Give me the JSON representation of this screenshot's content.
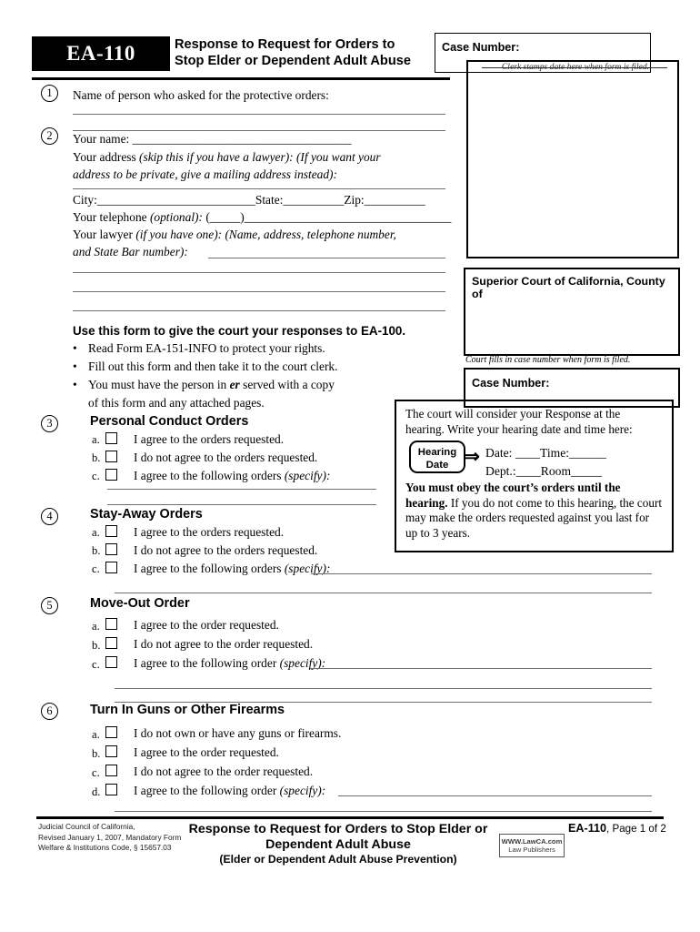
{
  "header": {
    "form_code": "EA-110",
    "title_line1": "Response to Request for Orders to",
    "title_line2": "Stop Elder or Dependent Adult Abuse"
  },
  "case_number_top": {
    "label": "Case Number:"
  },
  "clerk_stamp": {
    "note": "Clerk stamps date here when form is filed."
  },
  "court_box": {
    "label": "Superior Court of California, County of"
  },
  "court_fills_note": "Court fills in case number when form is filed.",
  "case_number_bottom": {
    "label": "Case Number:"
  },
  "hearing": {
    "intro_line1": "The court will consider your Response at the",
    "intro_line2": "hearing. Write your hearing date and time here:",
    "badge_line1": "Hearing",
    "badge_line2": "Date",
    "arrow": "⇒",
    "field_date": "Date: ____",
    "field_time": "Time:______",
    "field_dept": "Dept.:____",
    "field_room": "Room_____",
    "warn_bold": "You must obey the court’s orders until the hearing.",
    "warn_rest": " If you do not come to this hearing, the court may make the orders requested against you last for up to 3 years."
  },
  "item1": {
    "number": "1",
    "text": "Name of person who asked for the protective orders:"
  },
  "item2": {
    "number": "2",
    "your_name": "Your name: ____________________________________",
    "address_line1_plain": "Your address ",
    "address_line1_italic": "(skip this if you have a lawyer): (If you want your",
    "address_line2_italic": "address to be private, give a mailing address instead):",
    "city_line": "City:__________________________State:__________Zip:__________",
    "telephone_plain": "Your telephone ",
    "telephone_italic": "(optional): ",
    "telephone_rest": "(_____)__________________________________",
    "lawyer_plain": "Your lawyer ",
    "lawyer_italic1": "(if you have one): (Name, address, telephone number,",
    "lawyer_italic2": "and State Bar number):"
  },
  "instructions": {
    "heading": "Use this form to give the court your responses to EA-100.",
    "bullets": [
      "Read Form EA-151-INFO to protect your rights.",
      "Fill out this form and then take it to the court clerk.",
      "You must have the person in er served with a copy",
      "of this form and any attached pages."
    ],
    "bullet3_pre": "You must have the person in ",
    "bullet3_glyph": "er",
    "bullet3_post": " served with a copy",
    "bullet_marker": "•"
  },
  "item3": {
    "number": "3",
    "heading": "Personal Conduct Orders",
    "options": [
      {
        "letter": "a.",
        "text": "I agree to the orders requested."
      },
      {
        "letter": "b.",
        "text": "I do not agree to the orders requested."
      },
      {
        "letter": "c.",
        "text": "I agree to the following orders ",
        "italic": "(specify):"
      }
    ]
  },
  "item4": {
    "number": "4",
    "heading": "Stay-Away Orders",
    "options": [
      {
        "letter": "a.",
        "text": "I agree to the orders requested."
      },
      {
        "letter": "b.",
        "text": "I do not agree to the orders requested."
      },
      {
        "letter": "c.",
        "text": "I agree to the following orders ",
        "italic": "(specify):"
      }
    ]
  },
  "item5": {
    "number": "5",
    "heading": "Move-Out Order",
    "options": [
      {
        "letter": "a.",
        "text": "I agree to the order requested."
      },
      {
        "letter": "b.",
        "text": "I do not agree to the order requested."
      },
      {
        "letter": "c.",
        "text": "I agree to the following order ",
        "italic": "(specify):"
      }
    ]
  },
  "item6": {
    "number": "6",
    "heading": "Turn In Guns or Other Firearms",
    "options": [
      {
        "letter": "a.",
        "text": "I do not own or have any guns or firearms."
      },
      {
        "letter": "b.",
        "text": "I agree to the order requested."
      },
      {
        "letter": "c.",
        "text": "I do not agree to the order requested."
      },
      {
        "letter": "d.",
        "text": "I agree to the following order ",
        "italic": "(specify):"
      }
    ]
  },
  "footer": {
    "left_line1": "Judicial Council of California,",
    "left_line2": "Revised January 1, 2007, Mandatory Form",
    "left_line3": "Welfare & Institutions Code, § 15657.03",
    "title_line1": "Response to Request for Orders to Stop Elder or",
    "title_line2": "Dependent Adult Abuse",
    "subtitle": "(Elder or Dependent Adult Abuse Prevention)",
    "form_code": "EA-110",
    "page_text": ", Page 1 of 2",
    "publisher_line1": "WWW.LawCA.com",
    "publisher_line2": "Law Publishers"
  }
}
